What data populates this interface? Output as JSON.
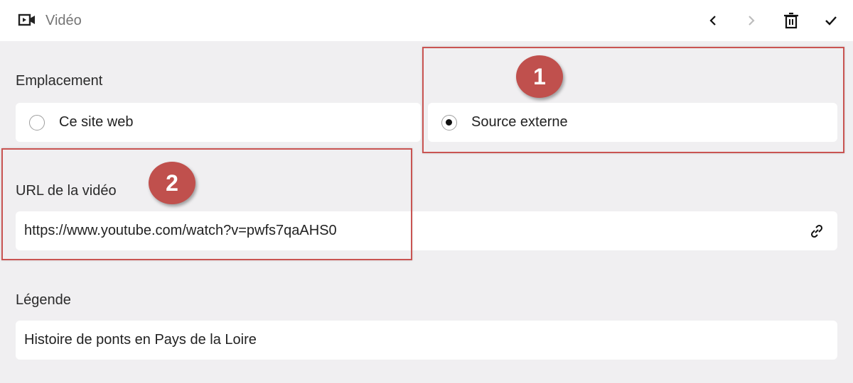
{
  "header": {
    "title": "Vidéo",
    "icons": [
      "video-icon",
      "chevron-left-icon",
      "chevron-right-icon",
      "trash-icon",
      "check-icon"
    ]
  },
  "location": {
    "label": "Emplacement",
    "options": [
      {
        "label": "Ce site web",
        "selected": false
      },
      {
        "label": "Source externe",
        "selected": true
      }
    ]
  },
  "video_url": {
    "label": "URL de la vidéo",
    "value": "https://www.youtube.com/watch?v=pwfs7qaAHS0",
    "icon": "link-icon"
  },
  "caption": {
    "label": "Légende",
    "value": "Histoire de ponts en Pays de la Loire"
  },
  "callouts": [
    {
      "number": "1"
    },
    {
      "number": "2"
    }
  ],
  "colors": {
    "callout": "#c0504d",
    "panel_bg": "#f0eff1",
    "field_bg": "#ffffff"
  }
}
